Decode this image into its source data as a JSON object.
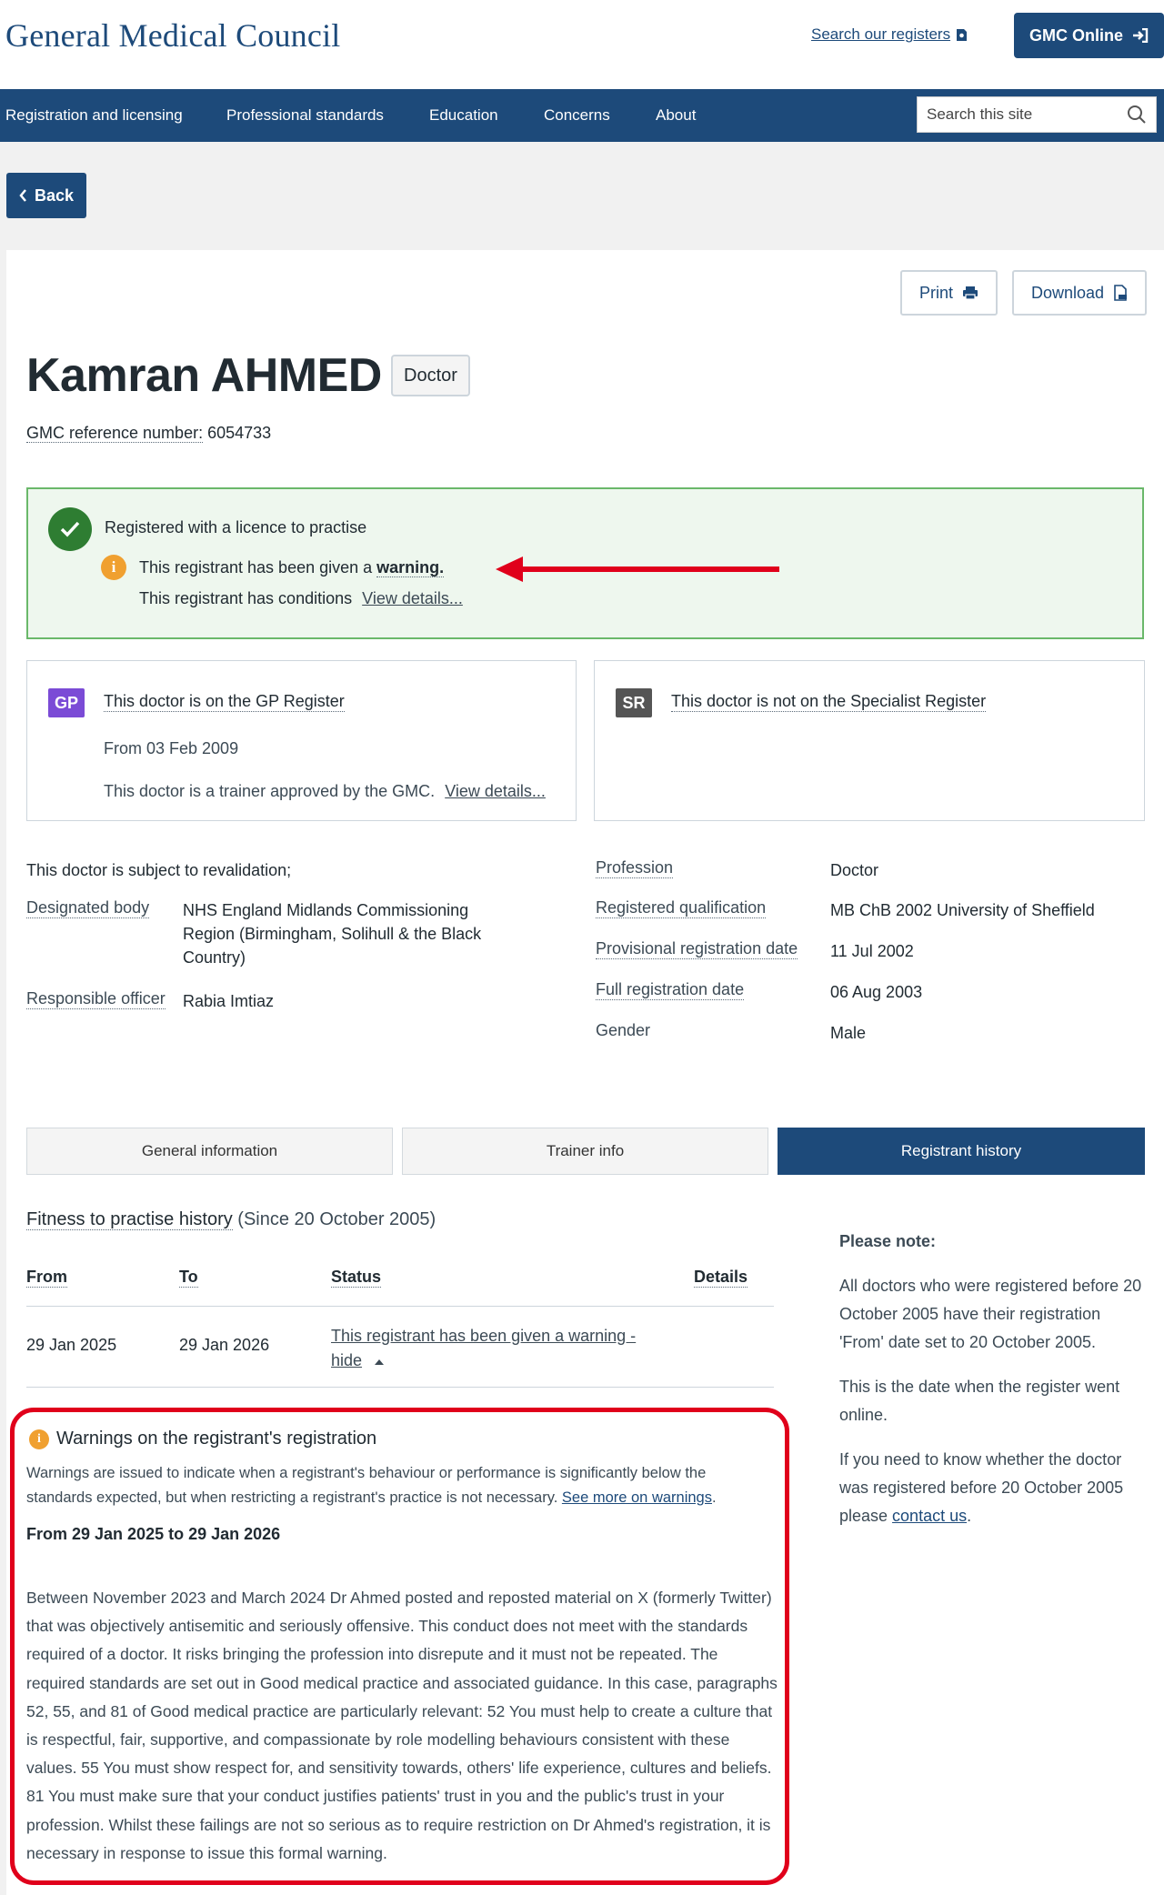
{
  "header": {
    "logo": "General Medical Council",
    "search_registers": "Search our registers",
    "gmc_online": "GMC Online"
  },
  "nav": {
    "items": [
      "Registration and licensing",
      "Professional standards",
      "Education",
      "Concerns",
      "About"
    ],
    "search_placeholder": "Search this site"
  },
  "back_label": "Back",
  "actions": {
    "print": "Print",
    "download": "Download"
  },
  "doctor": {
    "name": "Kamran AHMED",
    "badge": "Doctor",
    "ref_label": "GMC reference number:",
    "ref_number": "6054733"
  },
  "status": {
    "title": "Registered with a licence to practise",
    "warning_prefix": "This registrant has been given a ",
    "warning_word": "warning.",
    "conditions": "This registrant has conditions",
    "view_details": "View details..."
  },
  "gp": {
    "tag": "GP",
    "title": "This doctor is on the GP Register",
    "from": "From 03 Feb 2009",
    "trainer": "This doctor is a trainer approved by the GMC.",
    "view_details": "View details..."
  },
  "sr": {
    "tag": "SR",
    "title": "This doctor is not on the Specialist Register"
  },
  "revalidation": {
    "heading": "This doctor is subject to revalidation;",
    "designated_body_label": "Designated body",
    "designated_body_value": "NHS England Midlands Commissioning Region (Birmingham, Solihull & the Black Country)",
    "responsible_officer_label": "Responsible officer",
    "responsible_officer_value": "Rabia Imtiaz"
  },
  "details": {
    "profession_label": "Profession",
    "profession": "Doctor",
    "qualification_label": "Registered qualification",
    "qualification": "MB ChB 2002 University of Sheffield",
    "provisional_label": "Provisional registration date",
    "provisional": "11 Jul 2002",
    "full_label": "Full registration date",
    "full": "06 Aug 2003",
    "gender_label": "Gender",
    "gender": "Male"
  },
  "tabs": [
    "General information",
    "Trainer info",
    "Registrant history"
  ],
  "history": {
    "title": "Fitness to practise history",
    "since": " (Since 20 October 2005)",
    "columns": [
      "From",
      "To",
      "Status",
      "Details"
    ],
    "row": {
      "from": "29 Jan 2025",
      "to": "29 Jan 2026",
      "status_line1": "This registrant has been given a warning -",
      "status_line2": "hide"
    }
  },
  "note": {
    "title": "Please note:",
    "p1": "All doctors who were registered before 20 October 2005 have their registration 'From' date set to 20 October 2005.",
    "p2": "This is the date when the register went online.",
    "p3": "If you need to know whether the doctor was registered before 20 October 2005 please ",
    "contact": "contact us",
    "p3_end": "."
  },
  "warnings": {
    "heading": "Warnings on the registrant's registration",
    "intro": "Warnings are issued to indicate when a registrant's behaviour or performance is significantly below the standards expected, but when restricting a registrant's practice is not necessary. ",
    "see_more": "See more on warnings",
    "intro_end": ".",
    "period": "From 29 Jan 2025 to 29 Jan 2026",
    "body": "Between November 2023 and March 2024 Dr Ahmed posted and reposted material on X (formerly Twitter) that was objectively antisemitic and seriously offensive. This conduct does not meet with the standards required of a doctor. It risks bringing the profession into disrepute and it must not be repeated. The required standards are set out in Good medical practice and associated guidance. In this case, paragraphs 52, 55, and 81 of Good medical practice are particularly relevant: 52 You must help to create a culture that is respectful, fair, supportive, and compassionate by role modelling behaviours consistent with these values. 55 You must show respect for, and sensitivity towards, others' life experience, cultures and beliefs. 81 You must make sure that your conduct justifies patients' trust in you and the public's trust in your profession. Whilst these failings are not so serious as to require restriction on Dr Ahmed's registration, it is necessary in response to issue this formal warning."
  },
  "colors": {
    "brand": "#1d4a7a",
    "success": "#2e7d32",
    "warning": "#f0a030",
    "highlight": "#e0001b",
    "gp_tag": "#7b4bd6",
    "sr_tag": "#555555"
  },
  "icons": [
    "document-icon",
    "sign-in-icon",
    "search-icon",
    "chevron-left-icon",
    "printer-icon",
    "pdf-icon",
    "check-icon",
    "info-icon",
    "caret-up-icon",
    "arrow-annotation"
  ]
}
